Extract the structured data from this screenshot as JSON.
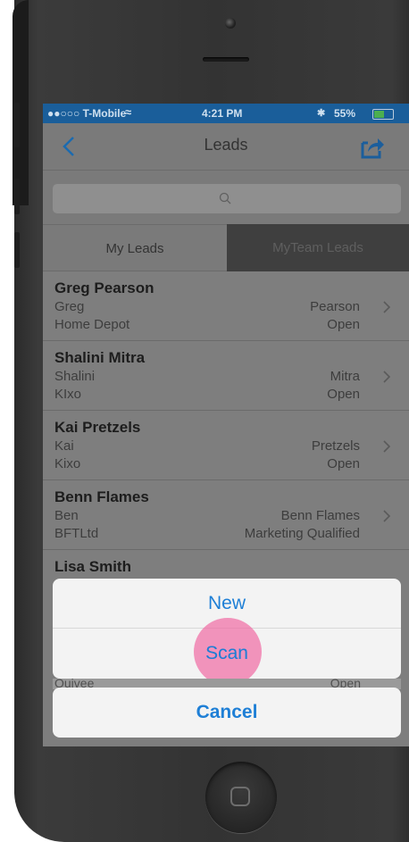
{
  "status_bar": {
    "carrier": "●●○○○ T-Mobile",
    "time": "4:21 PM",
    "battery": "55%"
  },
  "nav": {
    "title": "Leads"
  },
  "search": {
    "placeholder": ""
  },
  "tabs": [
    {
      "label": "My Leads",
      "selected": true
    },
    {
      "label": "MyTeam Leads",
      "selected": false
    }
  ],
  "leads": [
    {
      "name": "Greg Pearson",
      "first": "Greg",
      "last": "Pearson",
      "company": "Home Depot",
      "status": "Open"
    },
    {
      "name": "Shalini Mitra",
      "first": "Shalini",
      "last": "Mitra",
      "company": "KIxo",
      "status": "Open"
    },
    {
      "name": "Kai Pretzels",
      "first": "Kai",
      "last": "Pretzels",
      "company": "Kixo",
      "status": "Open"
    },
    {
      "name": "Benn Flames",
      "first": "Ben",
      "last": "Benn Flames",
      "company": "BFTLtd",
      "status": "Marketing Qualified"
    },
    {
      "name": "Lisa  Smith"
    }
  ],
  "partial_row": {
    "company": "Quivee",
    "status": "Open"
  },
  "action_sheet": {
    "new_label": "New",
    "scan_label": "Scan",
    "cancel_label": "Cancel"
  },
  "colors": {
    "status_bar": "#1a5e9a",
    "action_text": "#1e7fd6",
    "tap_highlight": "#f06ea5"
  }
}
